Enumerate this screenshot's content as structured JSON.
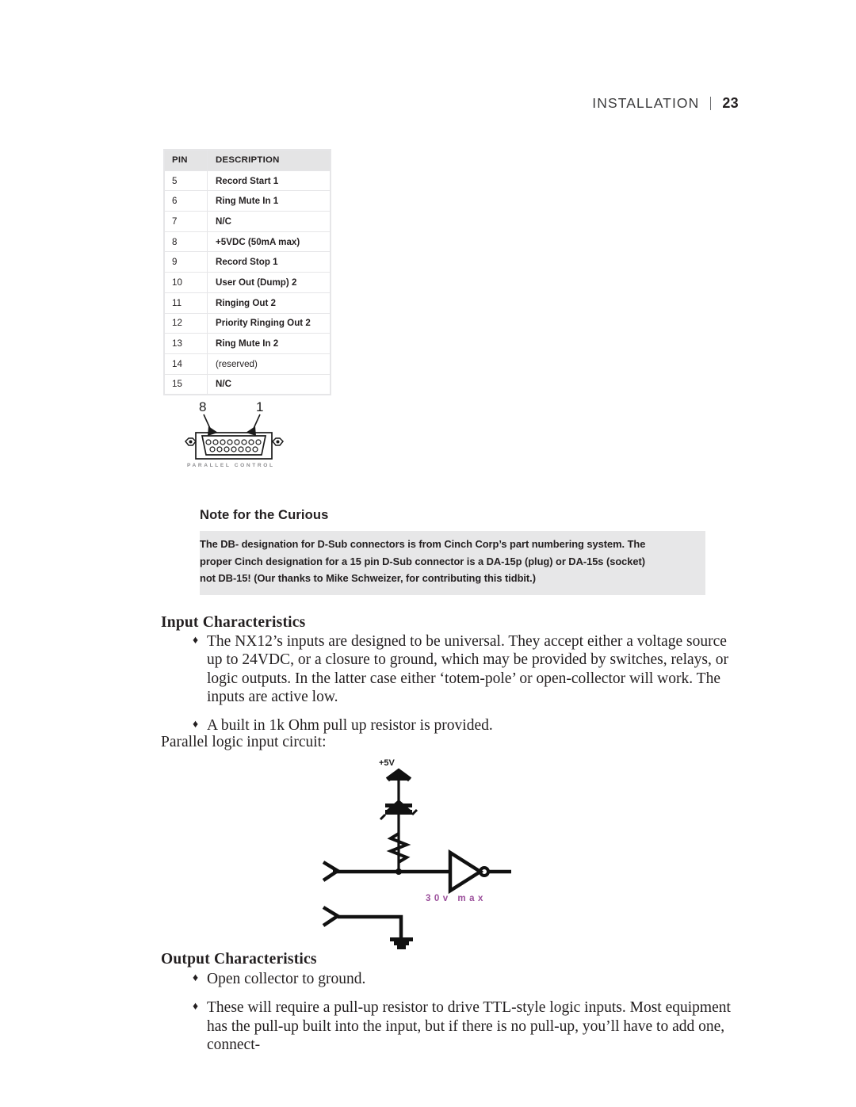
{
  "header": {
    "section_title": "INSTALLATION",
    "page_number": "23"
  },
  "pin_table": {
    "columns": [
      "PIN",
      "DESCRIPTION"
    ],
    "rows": [
      {
        "pin": "5",
        "description": "Record Start 1"
      },
      {
        "pin": "6",
        "description": "Ring Mute In 1"
      },
      {
        "pin": "7",
        "description": "N/C"
      },
      {
        "pin": "8",
        "description": "+5VDC (50mA max)"
      },
      {
        "pin": "9",
        "description": "Record Stop 1"
      },
      {
        "pin": "10",
        "description": "User Out (Dump) 2"
      },
      {
        "pin": "11",
        "description": "Ringing Out 2"
      },
      {
        "pin": "12",
        "description": "Priority Ringing Out 2"
      },
      {
        "pin": "13",
        "description": "Ring Mute In 2"
      },
      {
        "pin": "14",
        "description": "(reserved)"
      },
      {
        "pin": "15",
        "description": "N/C"
      }
    ]
  },
  "connector_figure": {
    "left_pin_label": "8",
    "right_pin_label": "1",
    "caption": "PARALLEL CONTROL",
    "top_row_pin_count": 8,
    "bottom_row_pin_count": 7
  },
  "note_section": {
    "heading": "Note for the Curious",
    "lines": [
      "The DB- designation for D-Sub connectors is from Cinch Corp’s part numbering system. The",
      "proper Cinch designation for a 15 pin D-Sub connector is a DA-15p (plug) or DA-15s (socket)",
      "not DB-15! (Our thanks to Mike Schweizer, for contributing this tidbit.)"
    ],
    "background_color": "#e7e7e8"
  },
  "input_characteristics": {
    "heading": "Input Characteristics",
    "bullet_glyph": "♦",
    "bullets": [
      "The NX12’s inputs are designed to be universal. They accept either a voltage source up to 24VDC, or a closure to ground, which may be provided by switches, relays, or logic outputs. In the latter case either ‘totem-pole’ or open-collector will work. The inputs are active low.",
      "A built in 1k Ohm pull up resistor is provided."
    ],
    "caption": "Parallel logic input circuit:"
  },
  "circuit_figure": {
    "supply_label": "+5V",
    "max_voltage_label": "30v max",
    "max_voltage_color": "#9b4f9b",
    "components": [
      "supply-arrow",
      "zener-diode",
      "resistor",
      "junction-node",
      "inverter-gate",
      "ground-symbol"
    ]
  },
  "output_characteristics": {
    "heading": "Output Characteristics",
    "bullet_glyph": "♦",
    "bullets": [
      "Open collector to ground.",
      "These will require a pull-up resistor to drive TTL-style logic inputs. Most equipment has the pull-up built into the input, but if there is no pull-up, you’ll have to add one, connect-"
    ]
  }
}
